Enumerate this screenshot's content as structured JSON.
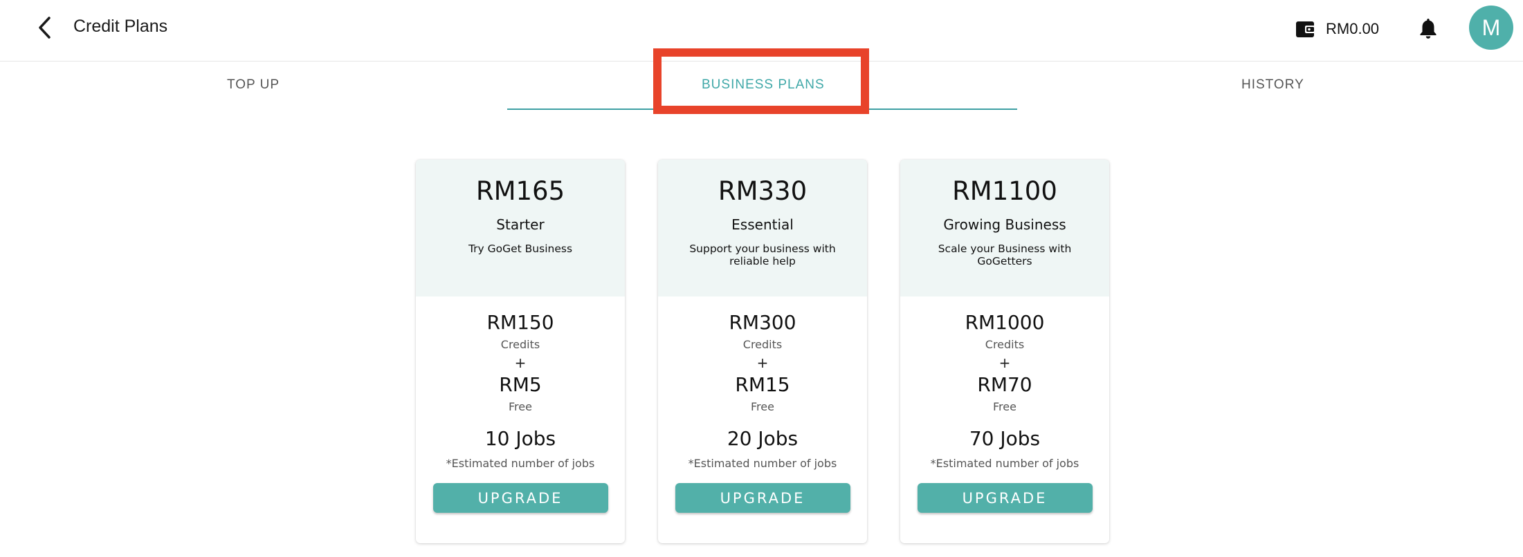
{
  "header": {
    "title": "Credit Plans",
    "back_icon": "chevron-left-icon",
    "wallet_icon": "wallet-icon",
    "wallet_amount": "RM0.00",
    "notification_icon": "bell-icon",
    "avatar_initial": "M",
    "avatar_color": "#4fb0aa"
  },
  "tabs": [
    {
      "label": "TOP UP",
      "active": false
    },
    {
      "label": "BUSINESS PLANS",
      "active": true
    },
    {
      "label": "HISTORY",
      "active": false
    }
  ],
  "colors": {
    "accent": "#3fa8a8",
    "button": "#52b0a9",
    "card_header_bg": "#eff6f5",
    "highlight": "#e8432a"
  },
  "plans": [
    {
      "price": "RM165",
      "name": "Starter",
      "description": "Try GoGet Business",
      "credits": "RM150",
      "credits_label": "Credits",
      "plus": "+",
      "free": "RM5",
      "free_label": "Free",
      "jobs": "10 Jobs",
      "jobs_note": "*Estimated number of jobs",
      "button_label": "UPGRADE"
    },
    {
      "price": "RM330",
      "name": "Essential",
      "description": "Support your business with reliable help",
      "credits": "RM300",
      "credits_label": "Credits",
      "plus": "+",
      "free": "RM15",
      "free_label": "Free",
      "jobs": "20 Jobs",
      "jobs_note": "*Estimated number of jobs",
      "button_label": "UPGRADE"
    },
    {
      "price": "RM1100",
      "name": "Growing Business",
      "description": "Scale your Business with GoGetters",
      "credits": "RM1000",
      "credits_label": "Credits",
      "plus": "+",
      "free": "RM70",
      "free_label": "Free",
      "jobs": "70 Jobs",
      "jobs_note": "*Estimated number of jobs",
      "button_label": "UPGRADE"
    }
  ]
}
